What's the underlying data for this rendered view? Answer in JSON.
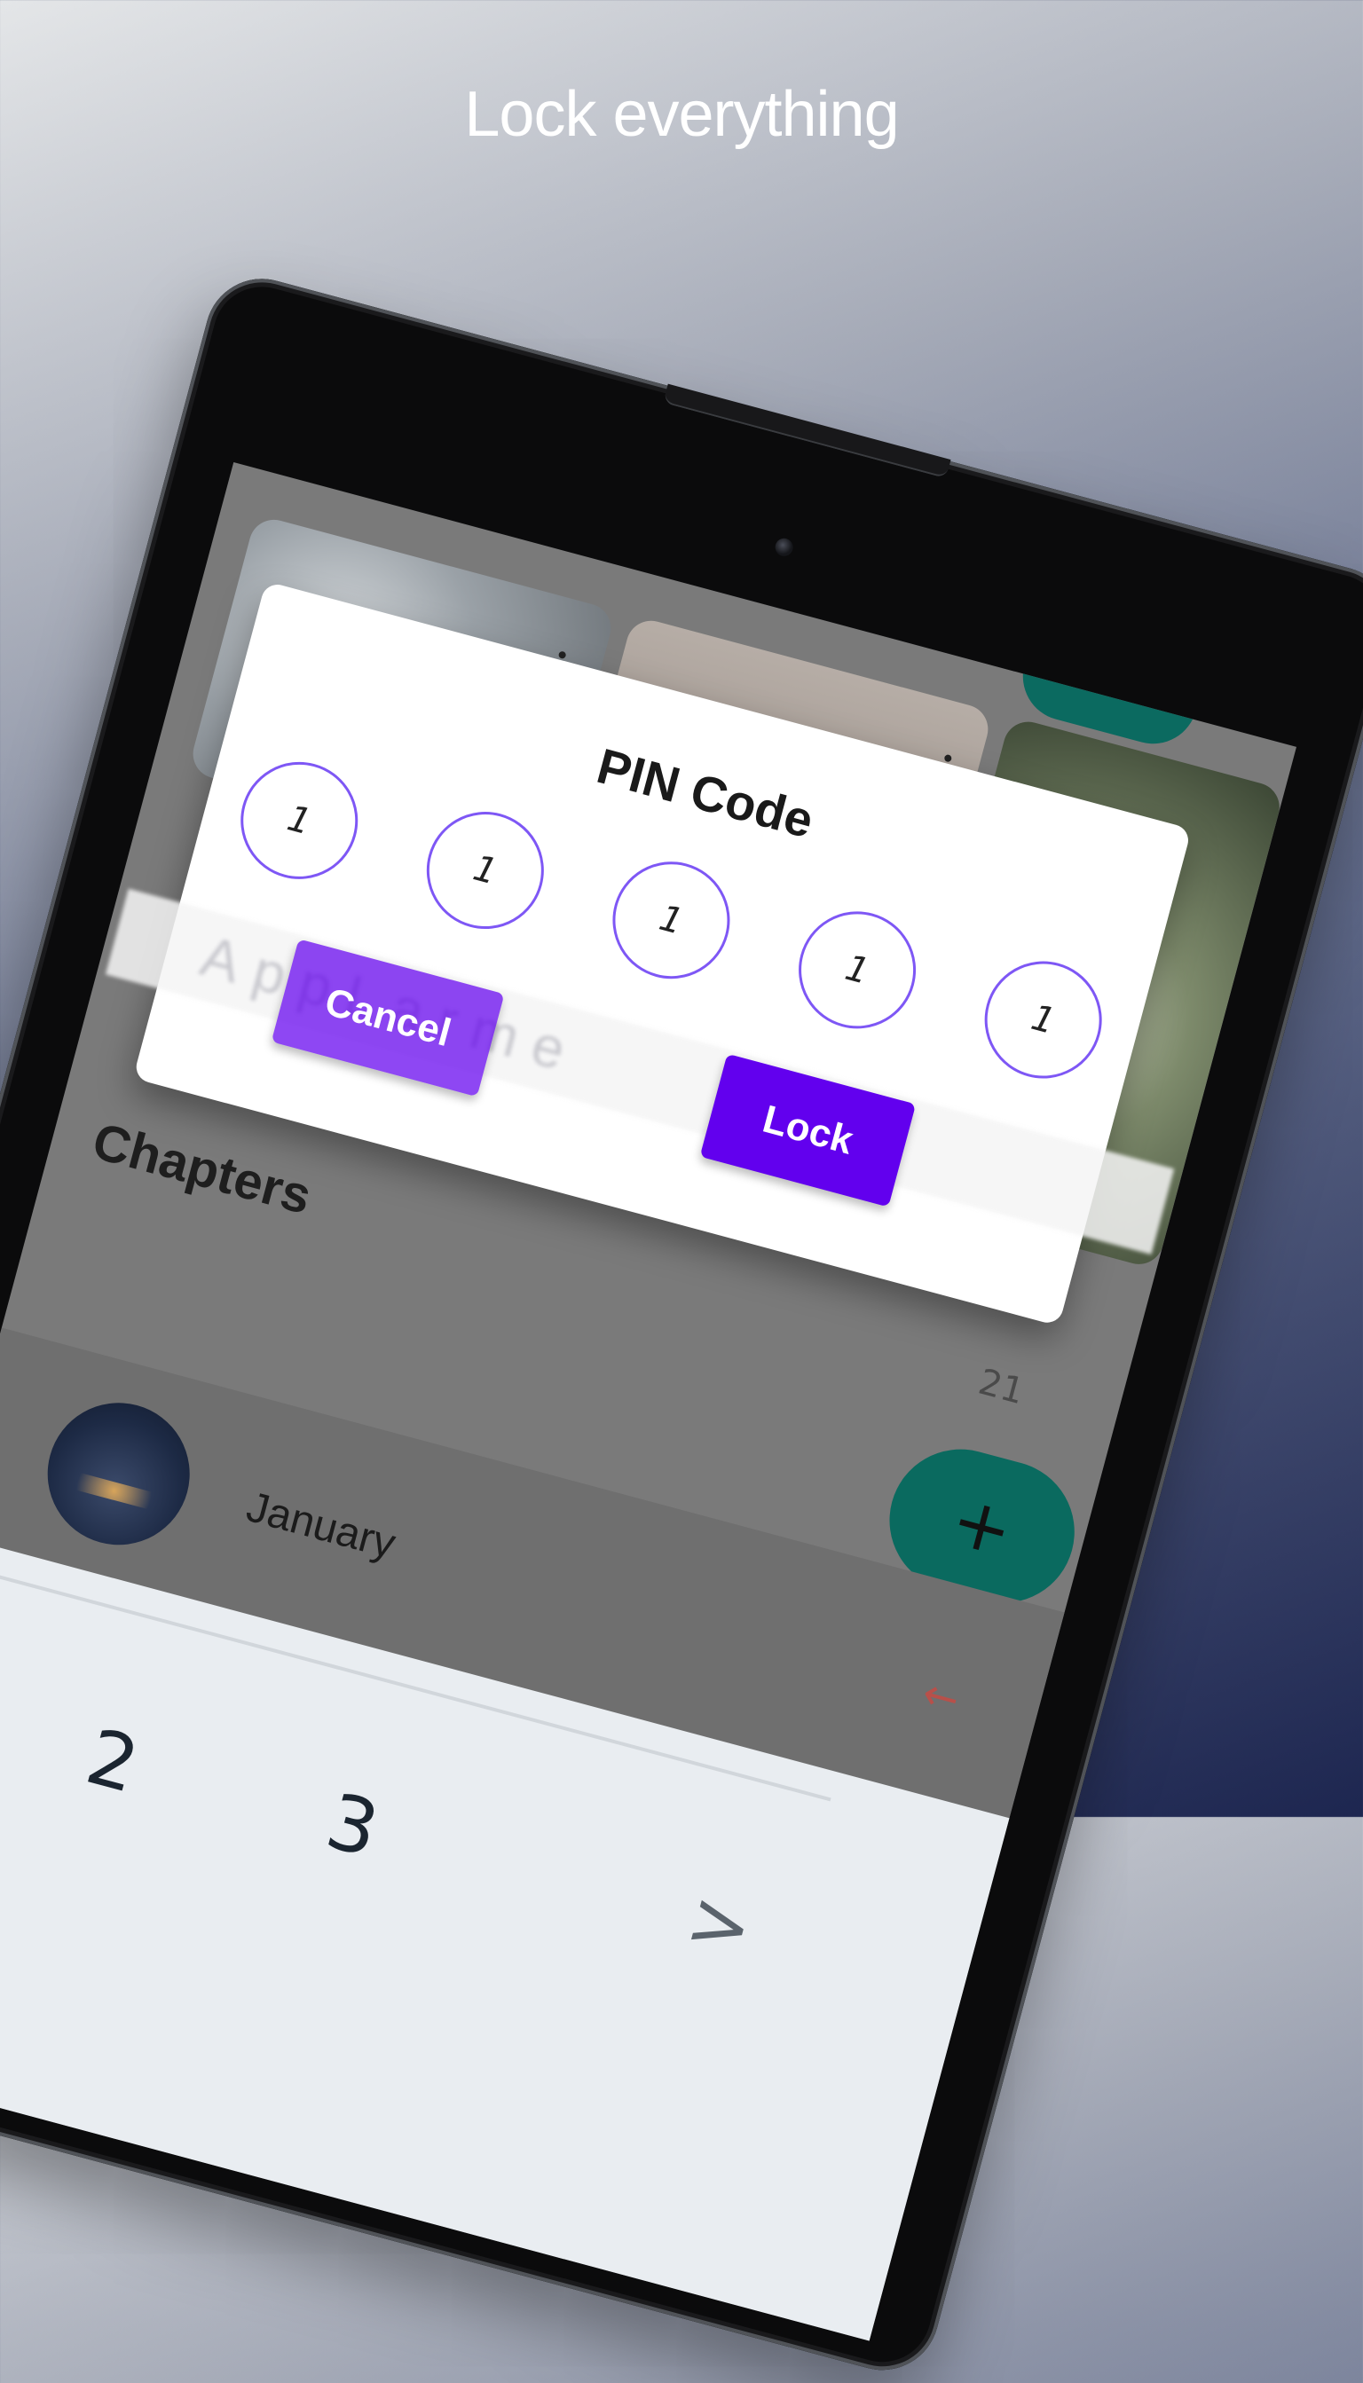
{
  "headline": "Lock everything",
  "background": {
    "chapters_title": "Chapters",
    "date_fragment": "21",
    "fab_icon": "+",
    "list_item_month": "January",
    "back_arrow": "←"
  },
  "dialog": {
    "title": "PIN Code",
    "pin_digits": [
      "1",
      "1",
      "1",
      "1",
      "1"
    ],
    "ghost_text": "AppLarme",
    "cancel_label": "Cancel",
    "lock_label": "Lock"
  },
  "keyboard": {
    "keys": [
      "2",
      "3"
    ],
    "next_icon": ">"
  },
  "colors": {
    "accent": "#6200ee",
    "pin_border": "#7e57f5",
    "fab": "#0a6a5f"
  }
}
